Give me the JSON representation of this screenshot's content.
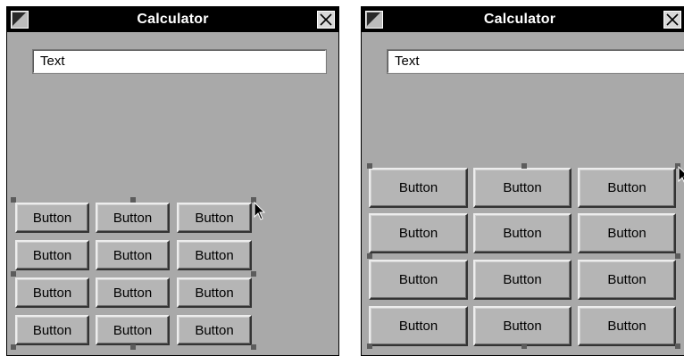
{
  "left_window": {
    "title": "Calculator",
    "text_field_value": "Text",
    "buttons": [
      "Button",
      "Button",
      "Button",
      "Button",
      "Button",
      "Button",
      "Button",
      "Button",
      "Button",
      "Button",
      "Button",
      "Button"
    ]
  },
  "right_window": {
    "title": "Calculator",
    "text_field_value": "Text",
    "buttons": [
      "Button",
      "Button",
      "Button",
      "Button",
      "Button",
      "Button",
      "Button",
      "Button",
      "Button",
      "Button",
      "Button",
      "Button"
    ]
  },
  "icons": {
    "window_menu": "window-menu-icon",
    "close": "close-icon",
    "cursor": "mouse-pointer-icon",
    "selection_handle": "resize-handle-icon"
  },
  "colors": {
    "window_background": "#a9a9a9",
    "titlebar": "#000000",
    "title_text": "#ffffff",
    "text_field": "#ffffff",
    "button_face": "#b5b5b5",
    "handle": "#5c5c5c"
  }
}
